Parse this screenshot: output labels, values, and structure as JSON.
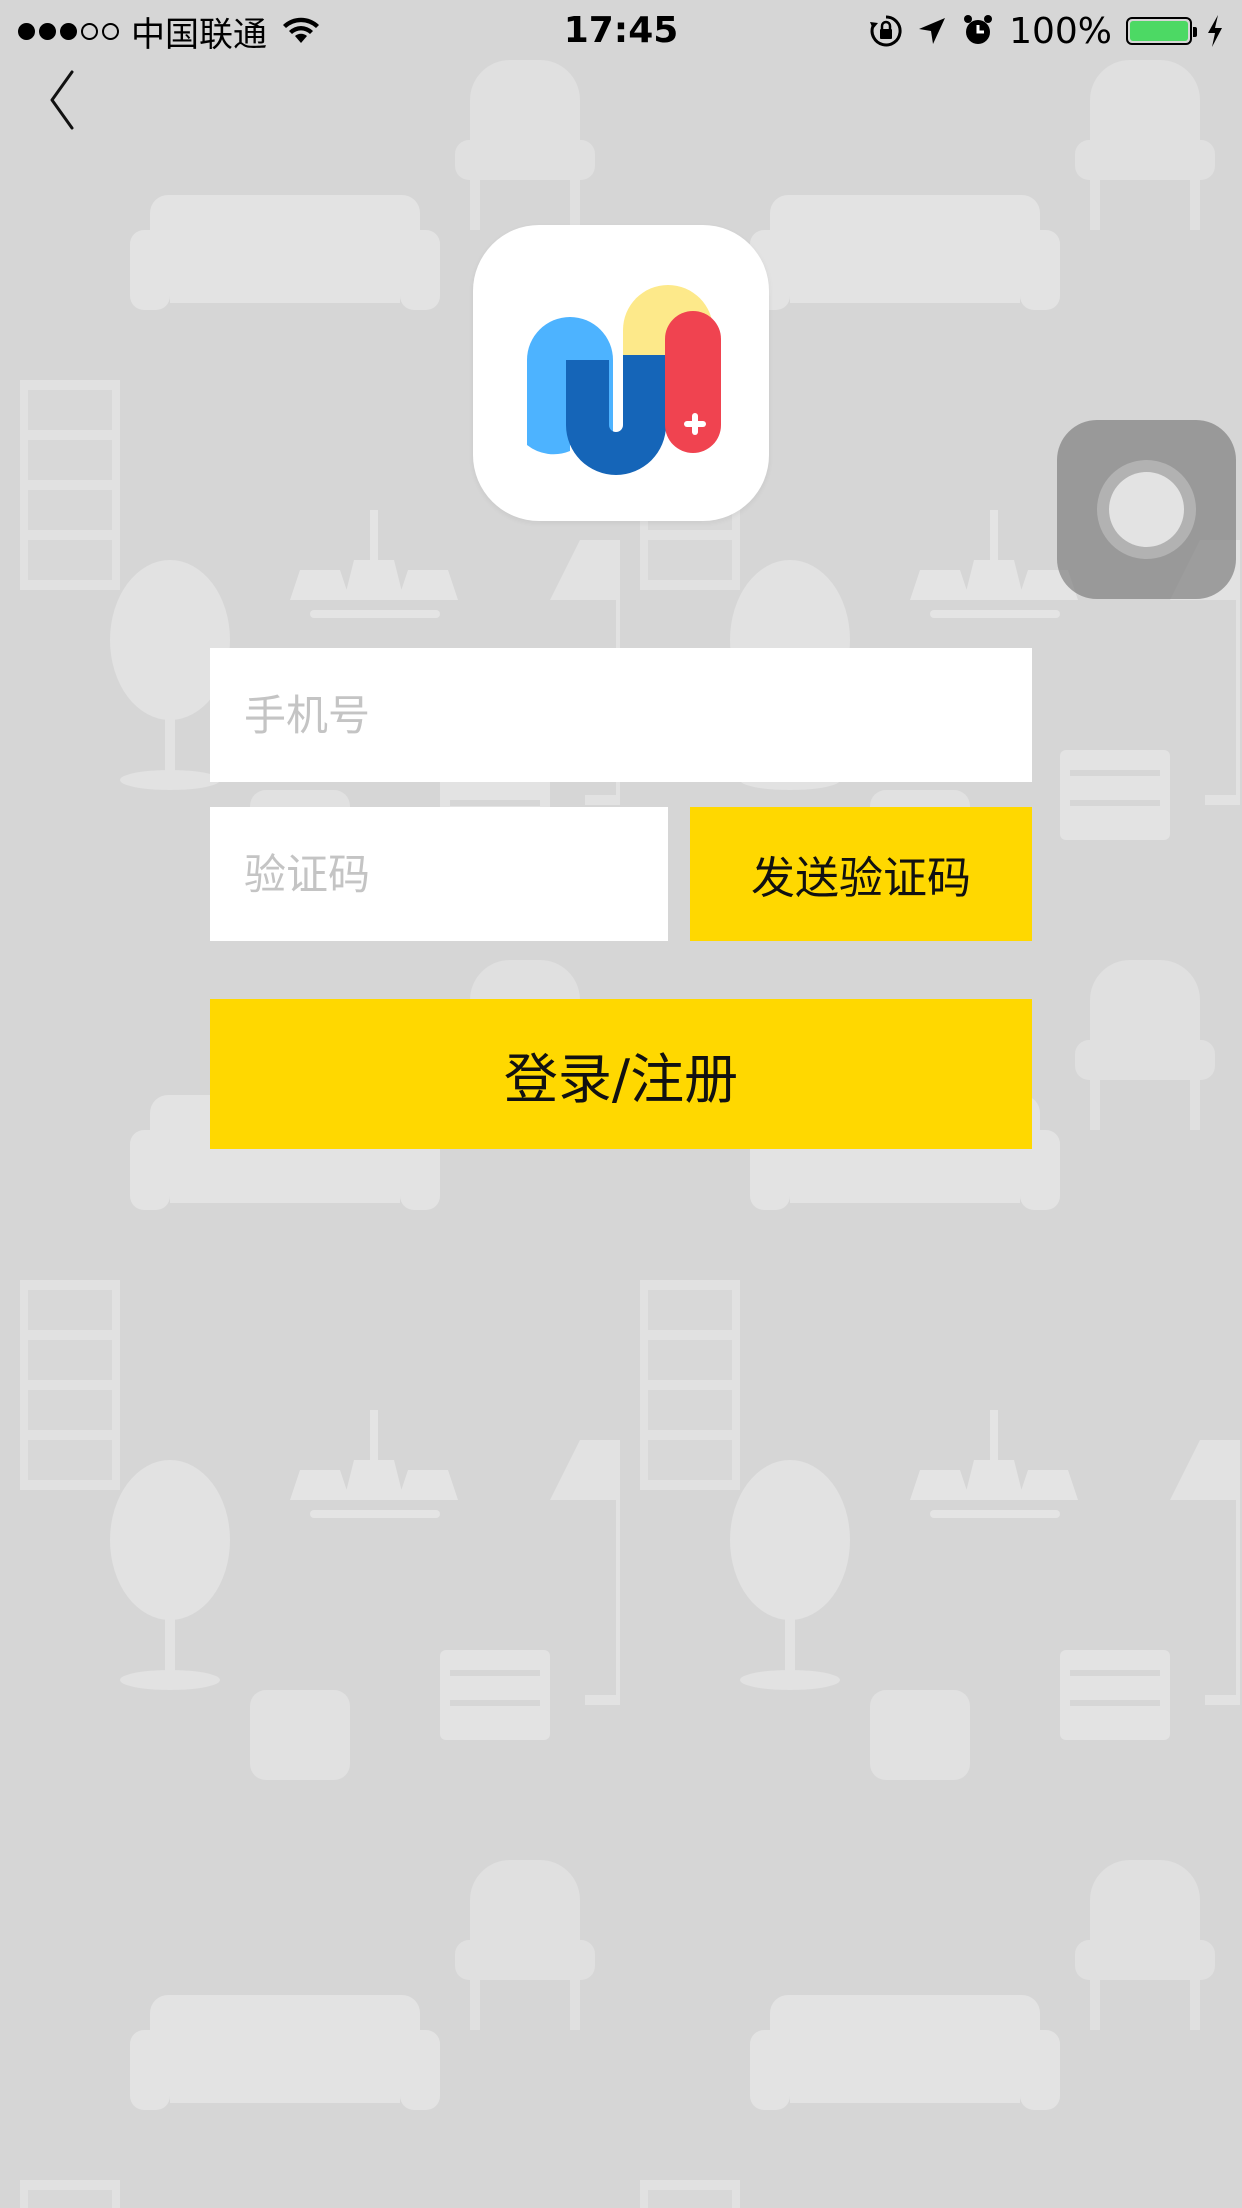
{
  "status_bar": {
    "signal_full": 3,
    "signal_total": 5,
    "carrier": "中国联通",
    "time": "17:45",
    "battery": "100%",
    "battery_level": 1.0,
    "battery_color": "#4cd964",
    "icons": [
      "wifi-icon",
      "orientation-lock-icon",
      "location-icon",
      "alarm-icon",
      "charging-icon"
    ]
  },
  "nav": {
    "back_icon": "chevron-left-icon"
  },
  "app": {
    "logo_icon": "app-logo-icon",
    "logo_colors": [
      "#4db3ff",
      "#1565b8",
      "#fde98a",
      "#f04350"
    ]
  },
  "form": {
    "phone_placeholder": "手机号",
    "code_placeholder": "验证码",
    "send_code_label": "发送验证码",
    "login_label": "登录/注册"
  },
  "colors": {
    "accent": "#ffd800",
    "background": "#d6d6d6"
  }
}
